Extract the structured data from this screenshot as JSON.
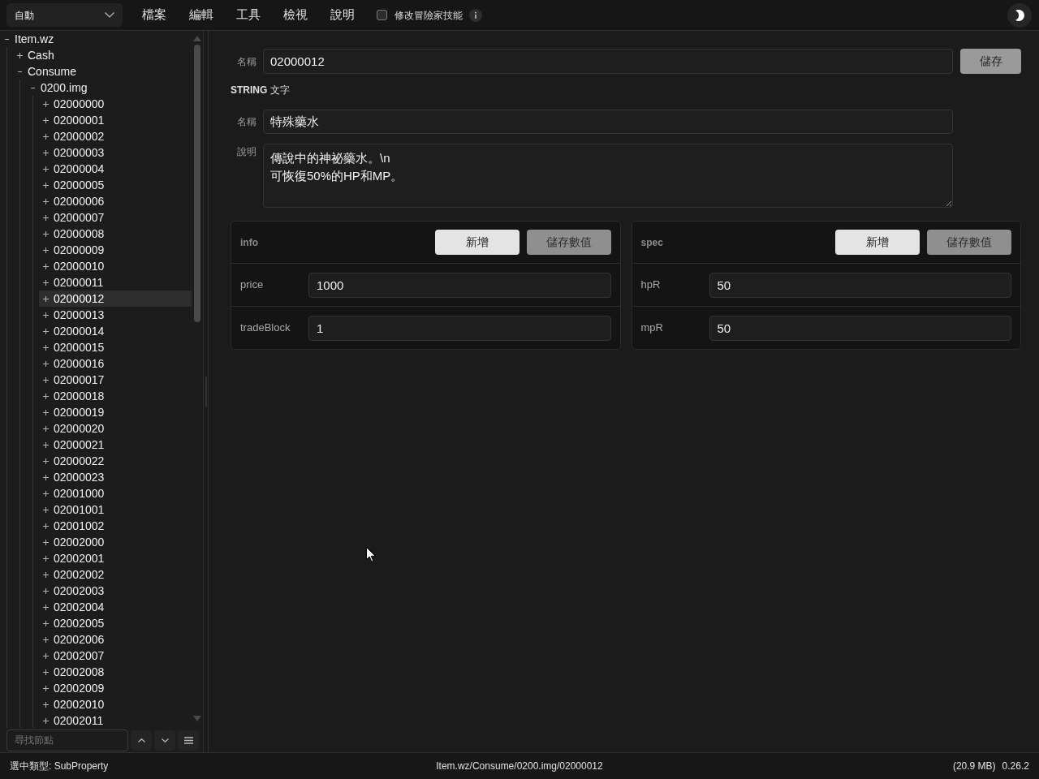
{
  "toolbar": {
    "mode_dropdown": {
      "value": "自動"
    },
    "menu": [
      "檔案",
      "編輯",
      "工具",
      "檢視",
      "說明"
    ],
    "checkbox": {
      "label": "修改冒險家技能",
      "checked": false
    }
  },
  "tree": [
    {
      "label": "Item.wz",
      "expanded": true,
      "selected": false,
      "children": [
        {
          "label": "Cash",
          "expanded": false,
          "selected": false
        },
        {
          "label": "Consume",
          "expanded": true,
          "selected": false,
          "children": [
            {
              "label": "0200.img",
              "expanded": true,
              "selected": false,
              "children": [
                {
                  "label": "02000000",
                  "expanded": false,
                  "selected": false
                },
                {
                  "label": "02000001",
                  "expanded": false,
                  "selected": false
                },
                {
                  "label": "02000002",
                  "expanded": false,
                  "selected": false
                },
                {
                  "label": "02000003",
                  "expanded": false,
                  "selected": false
                },
                {
                  "label": "02000004",
                  "expanded": false,
                  "selected": false
                },
                {
                  "label": "02000005",
                  "expanded": false,
                  "selected": false
                },
                {
                  "label": "02000006",
                  "expanded": false,
                  "selected": false
                },
                {
                  "label": "02000007",
                  "expanded": false,
                  "selected": false
                },
                {
                  "label": "02000008",
                  "expanded": false,
                  "selected": false
                },
                {
                  "label": "02000009",
                  "expanded": false,
                  "selected": false
                },
                {
                  "label": "02000010",
                  "expanded": false,
                  "selected": false
                },
                {
                  "label": "02000011",
                  "expanded": false,
                  "selected": false
                },
                {
                  "label": "02000012",
                  "expanded": false,
                  "selected": true
                },
                {
                  "label": "02000013",
                  "expanded": false,
                  "selected": false
                },
                {
                  "label": "02000014",
                  "expanded": false,
                  "selected": false
                },
                {
                  "label": "02000015",
                  "expanded": false,
                  "selected": false
                },
                {
                  "label": "02000016",
                  "expanded": false,
                  "selected": false
                },
                {
                  "label": "02000017",
                  "expanded": false,
                  "selected": false
                },
                {
                  "label": "02000018",
                  "expanded": false,
                  "selected": false
                },
                {
                  "label": "02000019",
                  "expanded": false,
                  "selected": false
                },
                {
                  "label": "02000020",
                  "expanded": false,
                  "selected": false
                },
                {
                  "label": "02000021",
                  "expanded": false,
                  "selected": false
                },
                {
                  "label": "02000022",
                  "expanded": false,
                  "selected": false
                },
                {
                  "label": "02000023",
                  "expanded": false,
                  "selected": false
                },
                {
                  "label": "02001000",
                  "expanded": false,
                  "selected": false
                },
                {
                  "label": "02001001",
                  "expanded": false,
                  "selected": false
                },
                {
                  "label": "02001002",
                  "expanded": false,
                  "selected": false
                },
                {
                  "label": "02002000",
                  "expanded": false,
                  "selected": false
                },
                {
                  "label": "02002001",
                  "expanded": false,
                  "selected": false
                },
                {
                  "label": "02002002",
                  "expanded": false,
                  "selected": false
                },
                {
                  "label": "02002003",
                  "expanded": false,
                  "selected": false
                },
                {
                  "label": "02002004",
                  "expanded": false,
                  "selected": false
                },
                {
                  "label": "02002005",
                  "expanded": false,
                  "selected": false
                },
                {
                  "label": "02002006",
                  "expanded": false,
                  "selected": false
                },
                {
                  "label": "02002007",
                  "expanded": false,
                  "selected": false
                },
                {
                  "label": "02002008",
                  "expanded": false,
                  "selected": false
                },
                {
                  "label": "02002009",
                  "expanded": false,
                  "selected": false
                },
                {
                  "label": "02002010",
                  "expanded": false,
                  "selected": false
                },
                {
                  "label": "02002011",
                  "expanded": false,
                  "selected": false
                }
              ]
            }
          ]
        }
      ]
    }
  ],
  "tree_search": {
    "placeholder": "尋找節點"
  },
  "editor": {
    "name_field": {
      "label": "名稱",
      "value": "02000012"
    },
    "save_button": "儲存",
    "section_heading": "**STRING** 文字",
    "string_fields": [
      {
        "kind": "input",
        "label": "名稱",
        "value": "特殊藥水"
      },
      {
        "kind": "textarea",
        "label": "說明",
        "value": "傳說中的神祕藥水。\\n\n可恢復50%的HP和MP。"
      }
    ],
    "property_groups": [
      {
        "title": "info",
        "buttons": [
          {
            "kind": "add",
            "label": "新增"
          },
          {
            "kind": "save",
            "label": "儲存數值"
          }
        ],
        "properties": [
          {
            "key": "price",
            "value": "1000"
          },
          {
            "key": "tradeBlock",
            "value": "1"
          }
        ]
      },
      {
        "title": "spec",
        "buttons": [
          {
            "kind": "add",
            "label": "新增"
          },
          {
            "kind": "save",
            "label": "儲存數值"
          }
        ],
        "properties": [
          {
            "key": "hpR",
            "value": "50"
          },
          {
            "key": "mpR",
            "value": "50"
          }
        ]
      }
    ]
  },
  "status_bar": {
    "selected_type": "選中類型: SubProperty",
    "path": "Item.wz/Consume/0200.img/02000012",
    "file_size": "(20.9 MB)",
    "version": "0.26.2"
  }
}
